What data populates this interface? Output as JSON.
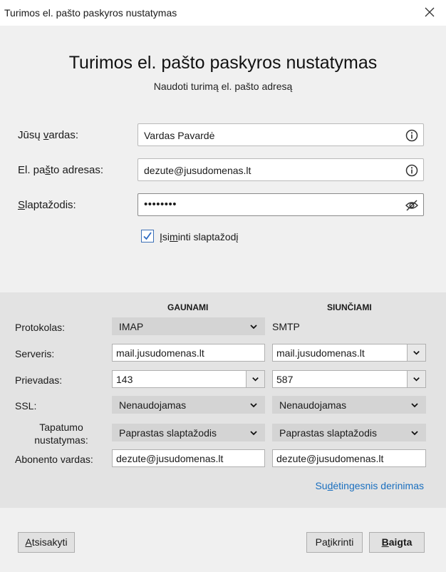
{
  "window": {
    "title": "Turimos el. pašto paskyros nustatymas"
  },
  "header": {
    "title": "Turimos el. pašto paskyros nustatymas",
    "subtitle": "Naudoti turimą el. pašto adresą"
  },
  "form": {
    "name_label_pre": "Jūsų ",
    "name_label_u": "v",
    "name_label_post": "ardas:",
    "name_value": "Vardas Pavardė",
    "email_label_pre": "El. pa",
    "email_label_u": "š",
    "email_label_post": "to adresas:",
    "email_value": "dezute@jusudomenas.lt",
    "password_label_u": "S",
    "password_label_post": "laptažodis:",
    "password_value": "••••••••",
    "remember_checked": true,
    "remember_label_u1": "Į",
    "remember_label_mid": "si",
    "remember_label_u2": "m",
    "remember_label_post": "inti slaptažodį"
  },
  "server": {
    "incoming_header": "GAUNAMI",
    "outgoing_header": "SIUNČIAMI",
    "labels": {
      "protocol": "Protokolas:",
      "server": "Serveris:",
      "port": "Prievadas:",
      "ssl": "SSL:",
      "auth_line1": "Tapatumo",
      "auth_line2": "nustatymas:",
      "username": "Abonento vardas:"
    },
    "incoming": {
      "protocol": "IMAP",
      "server": "mail.jusudomenas.lt",
      "port": "143",
      "ssl": "Nenaudojamas",
      "auth": "Paprastas slaptažodis",
      "username": "dezute@jusudomenas.lt"
    },
    "outgoing": {
      "protocol": "SMTP",
      "server": "mail.jusudomenas.lt",
      "port": "587",
      "ssl": "Nenaudojamas",
      "auth": "Paprastas slaptažodis",
      "username": "dezute@jusudomenas.lt"
    },
    "advanced_pre": "Su",
    "advanced_u": "d",
    "advanced_post": "ėtingesnis derinimas"
  },
  "buttons": {
    "cancel_u": "A",
    "cancel_post": "tsisakyti",
    "check_pre": "Pa",
    "check_u": "t",
    "check_post": "ikrinti",
    "done_u": "B",
    "done_post": "aigta"
  },
  "colors": {
    "accent": "#3b6fb6",
    "link": "#1a6fbf"
  }
}
